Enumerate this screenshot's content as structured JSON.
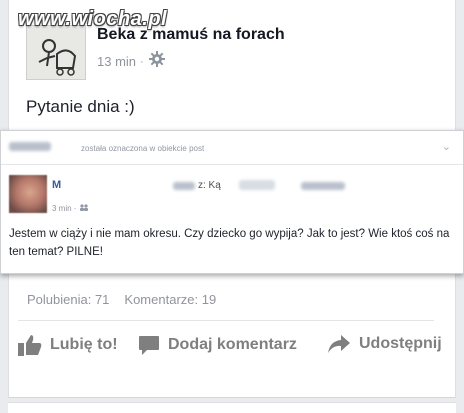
{
  "watermark": {
    "text": "www.wiocha.pl"
  },
  "post": {
    "page_name": "Beka z mamuś na forach",
    "time": "13 min",
    "separator": "·",
    "text": "Pytanie dnia :)"
  },
  "embedded": {
    "tagged_text": "została oznaczona w obiekcie post",
    "author_initial": "M",
    "to_label": "z: Ką",
    "time": "3 min ·",
    "text": "Jestem w ciąży i nie mam okresu. Czy dziecko go wypija? Jak to jest? Wie ktoś coś na ten temat? PILNE!"
  },
  "stats": {
    "likes": "Polubienia: 71",
    "comments": "Komentarze: 19"
  },
  "actions": {
    "like": "Lubię to!",
    "comment": "Dodaj komentarz",
    "share": "Udostępnij"
  },
  "icons": {
    "gear": "gear-icon",
    "friends": "friends-icon",
    "chevron": "chevron-down-icon",
    "like": "thumbs-up-icon",
    "comment": "comment-icon",
    "share": "share-arrow-icon"
  },
  "colors": {
    "background": "#e9ebee",
    "link_blue": "#3b5998",
    "meta_gray": "#90949c",
    "action_gray": "#7f7f7f"
  }
}
